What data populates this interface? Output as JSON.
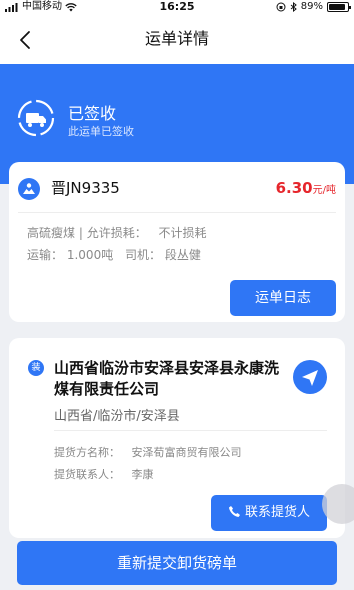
{
  "status_bar": {
    "carrier": "中国移动",
    "time": "16:25",
    "battery_percent": "89%",
    "battery_level": 0.89
  },
  "nav": {
    "title": "运单详情",
    "back_icon": "chevron-left-icon"
  },
  "status": {
    "title": "已签收",
    "subtitle": "此运单已签收",
    "icon": "truck-loading-icon"
  },
  "waybill": {
    "plate": "晋JN9335",
    "price": "6.30",
    "price_unit": "元/吨",
    "coal_type": "高硫瘦煤",
    "loss_label": "允许损耗：",
    "loss_value": "不计损耗",
    "transport_label": "运输：",
    "transport_value": "1.000吨",
    "driver_label": "司机：",
    "driver_value": "段丛健",
    "log_button": "运单日志"
  },
  "pickup": {
    "badge": "装",
    "address": "山西省临汾市安泽县安泽县永康洗煤有限责任公司",
    "region": "山西省/临汾市/安泽县",
    "provider_label": "提货方名称：",
    "provider_value": "安泽荀富商贸有限公司",
    "contact_label": "提货联系人：",
    "contact_value": "李康",
    "contact_button": "联系提货人"
  },
  "footer": {
    "resubmit_button": "重新提交卸货磅单"
  },
  "colors": {
    "primary": "#2f76f5",
    "price": "#e6262c"
  }
}
